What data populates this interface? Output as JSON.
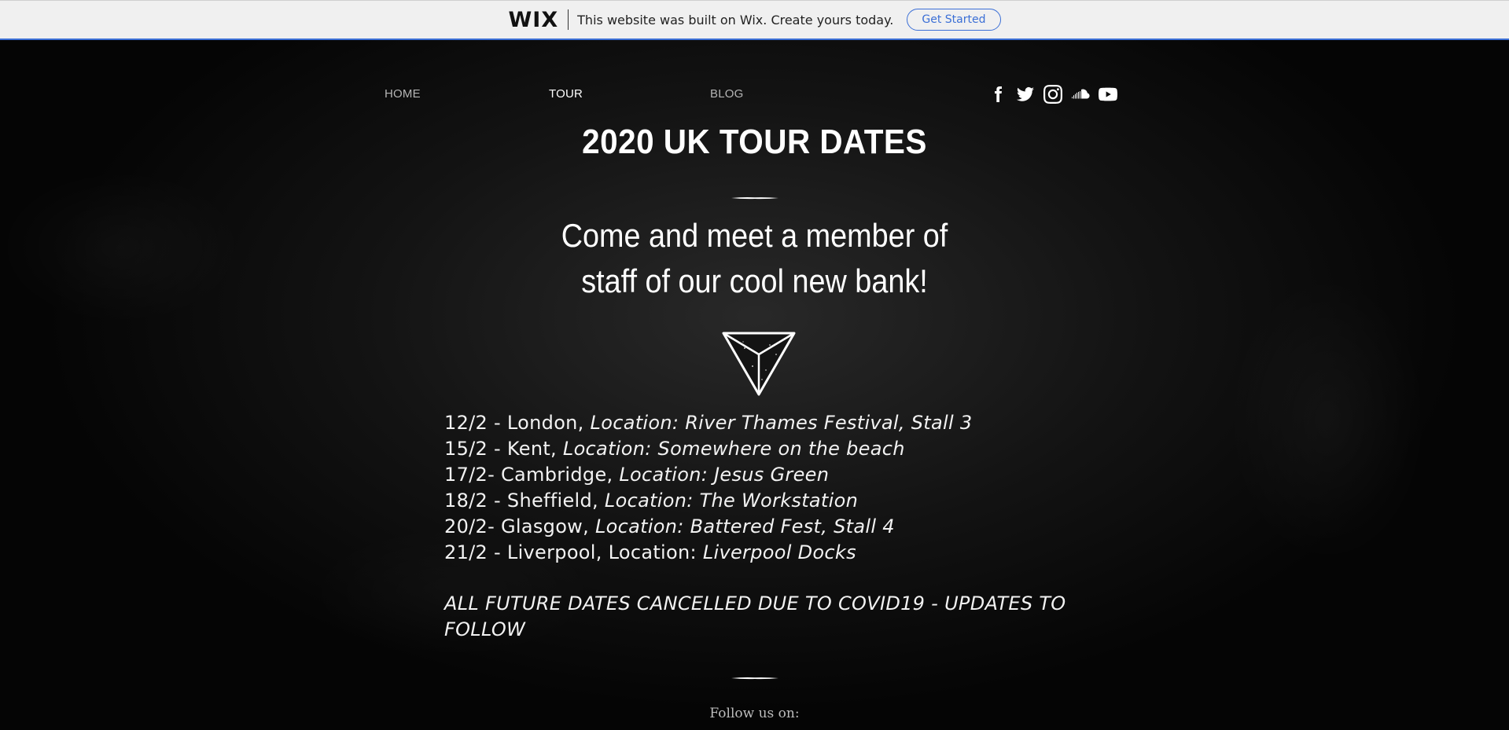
{
  "banner": {
    "logo": "WIX",
    "message": "This website was built on Wix. Create yours today.",
    "cta_label": "Get Started",
    "accent": "#3b6fd6"
  },
  "nav": {
    "items": [
      {
        "label": "HOME"
      },
      {
        "label": "TOUR"
      },
      {
        "label": "BLOG"
      }
    ],
    "active": "TOUR",
    "social": [
      "facebook-icon",
      "twitter-icon",
      "instagram-icon",
      "soundcloud-icon",
      "youtube-icon"
    ]
  },
  "main": {
    "title": "2020 UK TOUR DATES",
    "subtitle_line1": "Come and meet a member of",
    "subtitle_line2": "staff of our cool new bank!",
    "dates": [
      {
        "date_city": "12/2 - London, ",
        "location": "Location: River Thames Festival, Stall 3"
      },
      {
        "date_city": "15/2 - Kent, ",
        "location": "Location: Somewhere on the beach"
      },
      {
        "date_city": "17/2- Cambridge, ",
        "location": "Location: Jesus Green"
      },
      {
        "date_city": "18/2 - Sheffield, ",
        "location": "Location: The Workstation"
      },
      {
        "date_city": "20/2- Glasgow, ",
        "location": "Location: Battered Fest, Stall 4"
      },
      {
        "date_city": "21/2 - Liverpool, Location: ",
        "location": "Liverpool Docks"
      }
    ],
    "notice": "ALL FUTURE DATES CANCELLED DUE TO COVID19 - UPDATES TO FOLLOW",
    "follow_label": "Follow us on:"
  }
}
